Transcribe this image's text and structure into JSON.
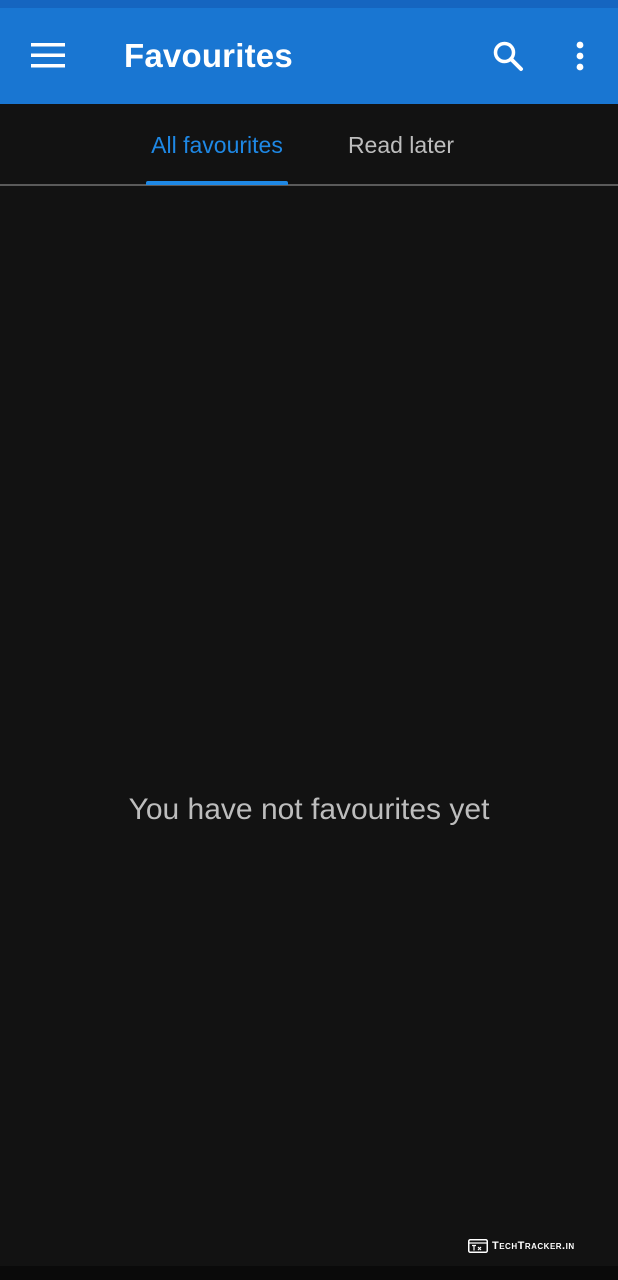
{
  "app_bar": {
    "title": "Favourites",
    "menu_icon": "hamburger-menu-icon",
    "search_icon": "search-icon",
    "more_icon": "more-vert-icon",
    "color": "#1976d2"
  },
  "tabs": [
    {
      "label": "All favourites",
      "selected": true
    },
    {
      "label": "Read later",
      "selected": false
    }
  ],
  "empty_state": {
    "message": "You have not favourites yet"
  },
  "watermark": {
    "text": "TechTracker.in",
    "icon": "browser-logo-icon"
  },
  "colors": {
    "accent": "#1e88e5",
    "background": "#121212",
    "inactive_text": "#bdbdbd"
  }
}
